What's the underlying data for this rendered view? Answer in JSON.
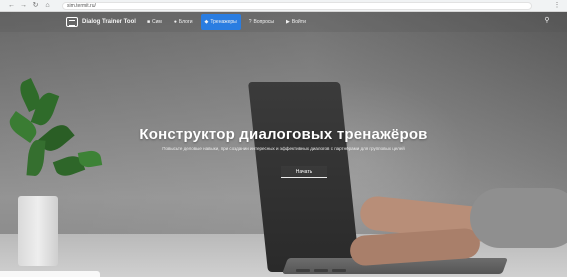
{
  "browser": {
    "icons": [
      "back-icon",
      "forward-icon",
      "reload-icon",
      "home-icon"
    ],
    "url_host": "sim.termit.ru/",
    "url_center": "",
    "menu_icon": "more-icon"
  },
  "nav": {
    "brand": "Dialog Trainer Tool",
    "links": [
      {
        "label": "Сим",
        "icon": "book-icon",
        "active": false
      },
      {
        "label": "Блоги",
        "icon": "blog-icon",
        "active": false
      },
      {
        "label": "Тренажеры",
        "icon": "trainer-icon",
        "active": true
      },
      {
        "label": "Вопросы",
        "icon": "question-icon",
        "active": false
      },
      {
        "label": "Войти",
        "icon": "login-icon",
        "active": false
      }
    ],
    "search_icon": "search-icon"
  },
  "hero": {
    "title": "Конструктор диалоговых тренажёров",
    "subtitle": "Повысьте деловые навыки, при создании интересных и эффективных диалогов с партнёрами для групповых целей",
    "button": "Начать"
  },
  "colors": {
    "accent": "#2a7de1",
    "overlay": "#6e6e6e",
    "text": "#ffffff"
  }
}
